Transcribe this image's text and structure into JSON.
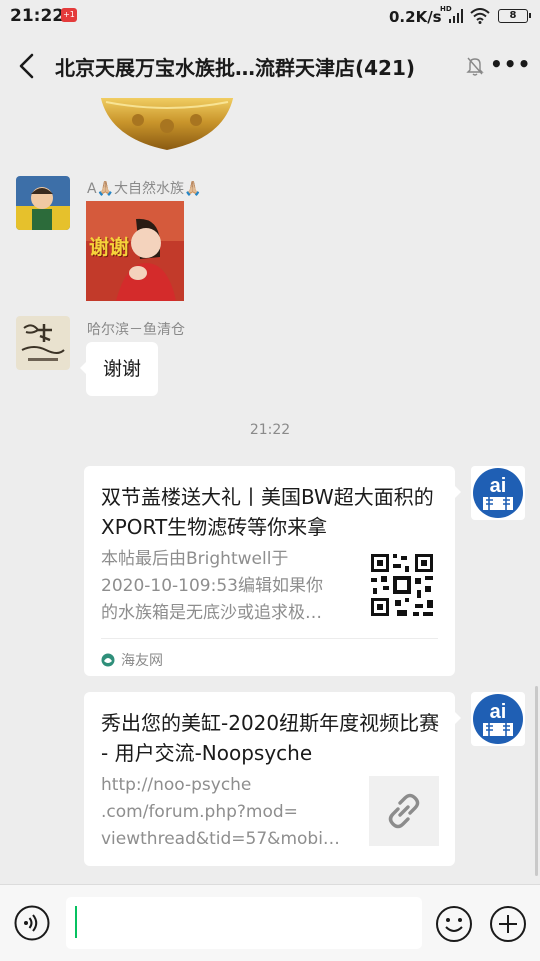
{
  "status_bar": {
    "time": "21:22",
    "app_badge": "+1",
    "net_speed": "0.2K/s",
    "hd": "HD",
    "battery": "8"
  },
  "header": {
    "title": "北京天展万宝水族批…流群天津店(421)",
    "more": "•••"
  },
  "messages": [
    {
      "sender": "A🙏🏼大自然水族🙏🏼",
      "type": "sticker",
      "sticker_text": "谢谢"
    },
    {
      "sender": "哈尔滨－鱼清仓",
      "type": "text",
      "text": "谢谢"
    }
  ],
  "time_divider": "21:22",
  "cards": [
    {
      "title": "双节盖楼送大礼丨美国BW超大面积的XPORT生物滤砖等你来拿",
      "desc": "本帖最后由Brightwell于\n2020-10-109:53编辑如果你\n的水族箱是无底沙或追求极…",
      "source": "海友网"
    },
    {
      "title": "秀出您的美缸-2020纽斯年度视频比赛 - 用户交流-Noopsyche",
      "desc": "http://noo-psyche\n.com/forum.php?mod=\nviewthread&tid=57&mobi…"
    }
  ],
  "input": {
    "value": ""
  },
  "colors": {
    "background": "#ededed",
    "accent": "#07c160",
    "avatar_blue": "#1f5fb4"
  }
}
